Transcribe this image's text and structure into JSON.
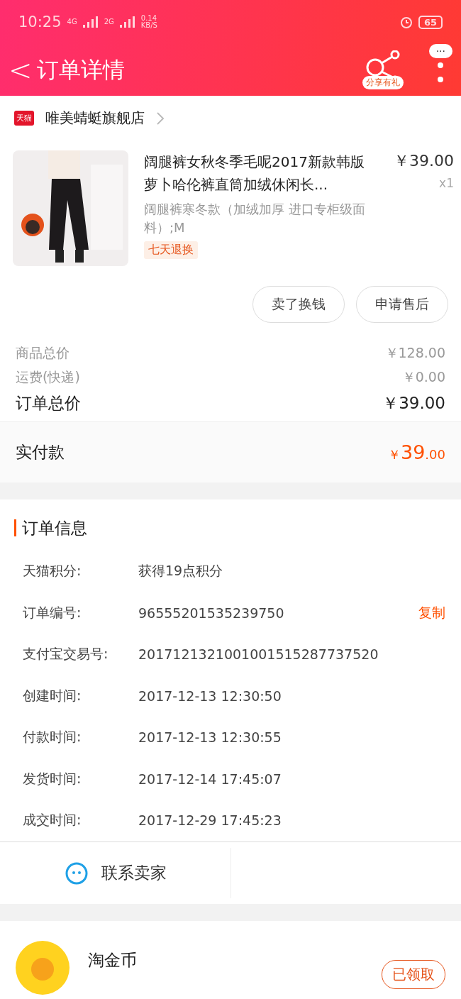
{
  "status_bar": {
    "time": "10:25",
    "net1": "4G",
    "net2": "2G",
    "speed": "0.14",
    "speed_unit": "KB/S",
    "battery": "65"
  },
  "header": {
    "back": "<",
    "title": "订单详情",
    "share_label": "分享有礼",
    "more": "···"
  },
  "shop": {
    "badge": "天猫",
    "name": "唯美蜻蜓旗舰店"
  },
  "product": {
    "title": "阔腿裤女秋冬季毛呢2017新款韩版萝卜哈伦裤直筒加绒休闲长...",
    "price": "￥39.00",
    "qty": "x1",
    "sku": "阔腿裤寒冬款（加绒加厚 进口专柜级面料）;M",
    "tag": "七天退换"
  },
  "actions": [
    "卖了换钱",
    "申请售后"
  ],
  "summary": [
    {
      "label": "商品总价",
      "value": "￥128.00",
      "kind": "minor"
    },
    {
      "label": "运费(快递)",
      "value": "￥0.00",
      "kind": "minor"
    },
    {
      "label": "订单总价",
      "value": "￥39.00",
      "kind": "major"
    }
  ],
  "paid": {
    "label": "实付款",
    "currency": "￥",
    "integer": "39",
    "decimal": ".00"
  },
  "order_info": {
    "title": "订单信息",
    "rows": [
      {
        "label": "天猫积分:",
        "value": "获得19点积分"
      },
      {
        "label": "订单编号:",
        "value": "96555201535239750",
        "action": "复制"
      },
      {
        "label": "支付宝交易号:",
        "value": "2017121321001001515287737520"
      },
      {
        "label": "创建时间:",
        "value": "2017-12-13 12:30:50"
      },
      {
        "label": "付款时间:",
        "value": "2017-12-13 12:30:55"
      },
      {
        "label": "发货时间:",
        "value": "2017-12-14 17:45:07"
      },
      {
        "label": "成交时间:",
        "value": "2017-12-29 17:45:23"
      }
    ]
  },
  "contact": {
    "label": "联系卖家"
  },
  "coin": {
    "title": "淘金币",
    "button": "已领取"
  }
}
